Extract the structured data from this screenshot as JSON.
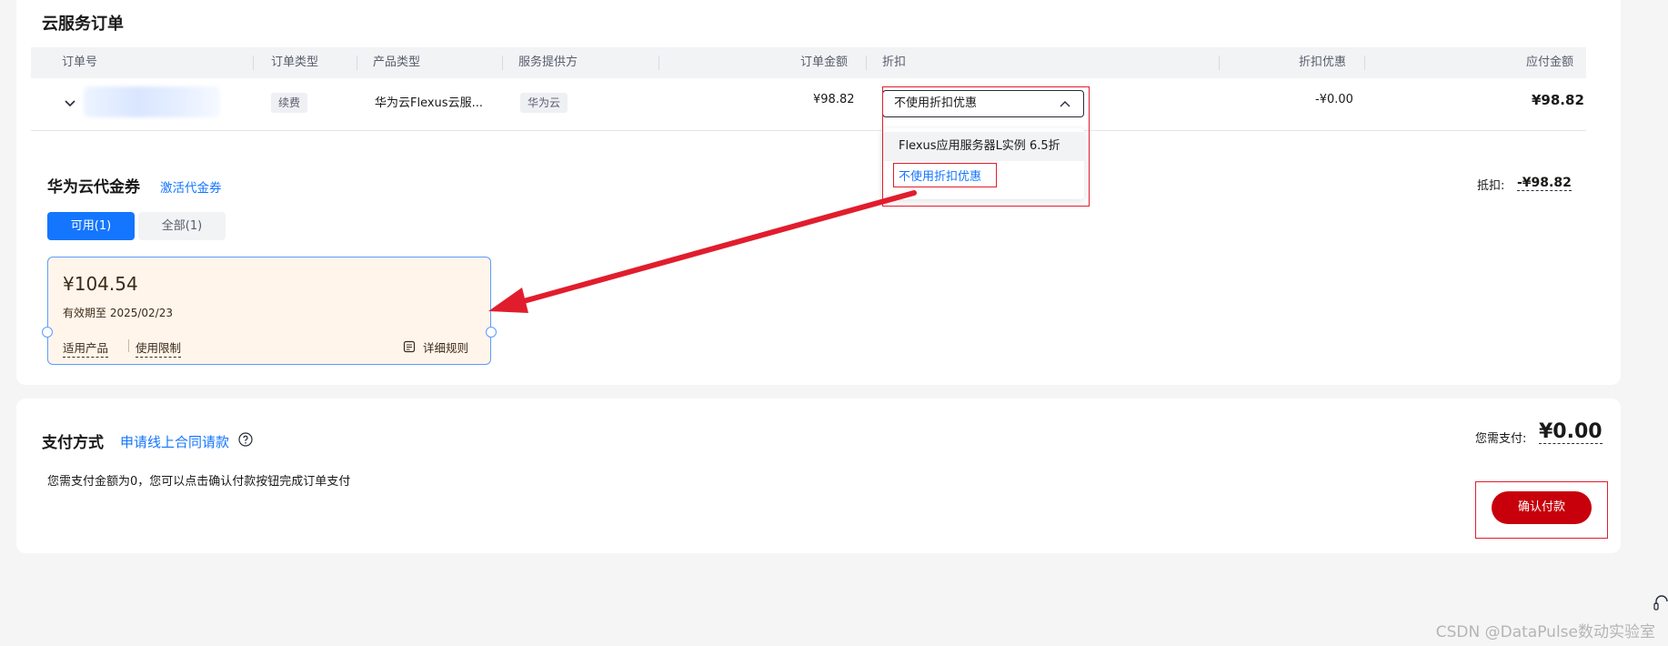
{
  "order_section": {
    "title": "云服务订单",
    "columns": [
      "订单号",
      "订单类型",
      "产品类型",
      "服务提供方",
      "订单金额",
      "折扣",
      "折扣优惠",
      "应付金额"
    ],
    "row": {
      "order_type": "续费",
      "product_type": "华为云Flexus云服...",
      "provider": "华为云",
      "amount": "¥98.82",
      "discount_selected": "不使用折扣优惠",
      "discount_value": "-¥0.00",
      "payable": "¥98.82"
    },
    "discount_options": [
      "Flexus应用服务器L实例 6.5折",
      "不使用折扣优惠"
    ]
  },
  "coupon_section": {
    "title": "华为云代金券",
    "activate_link": "激活代金券",
    "tabs": [
      "可用(1)",
      "全部(1)"
    ],
    "deduct_label": "抵扣:",
    "deduct_value": "-¥98.82",
    "coupon": {
      "amount": "¥104.54",
      "expiry": "有效期至 2025/02/23",
      "link_products": "适用产品",
      "link_limits": "使用限制",
      "rules": "详细规则"
    }
  },
  "payment_section": {
    "title": "支付方式",
    "contract_link": "申请线上合同请款",
    "description": "您需支付金额为0，您可以点击确认付款按钮完成订单支付",
    "need_pay_label": "您需支付:",
    "need_pay_value": "¥0.00",
    "confirm_button": "确认付款"
  },
  "watermark": "CSDN @DataPulse数动实验室",
  "colors": {
    "accent": "#1476ff",
    "primary_button": "#c7000b",
    "annotation": "#e11d2d"
  }
}
